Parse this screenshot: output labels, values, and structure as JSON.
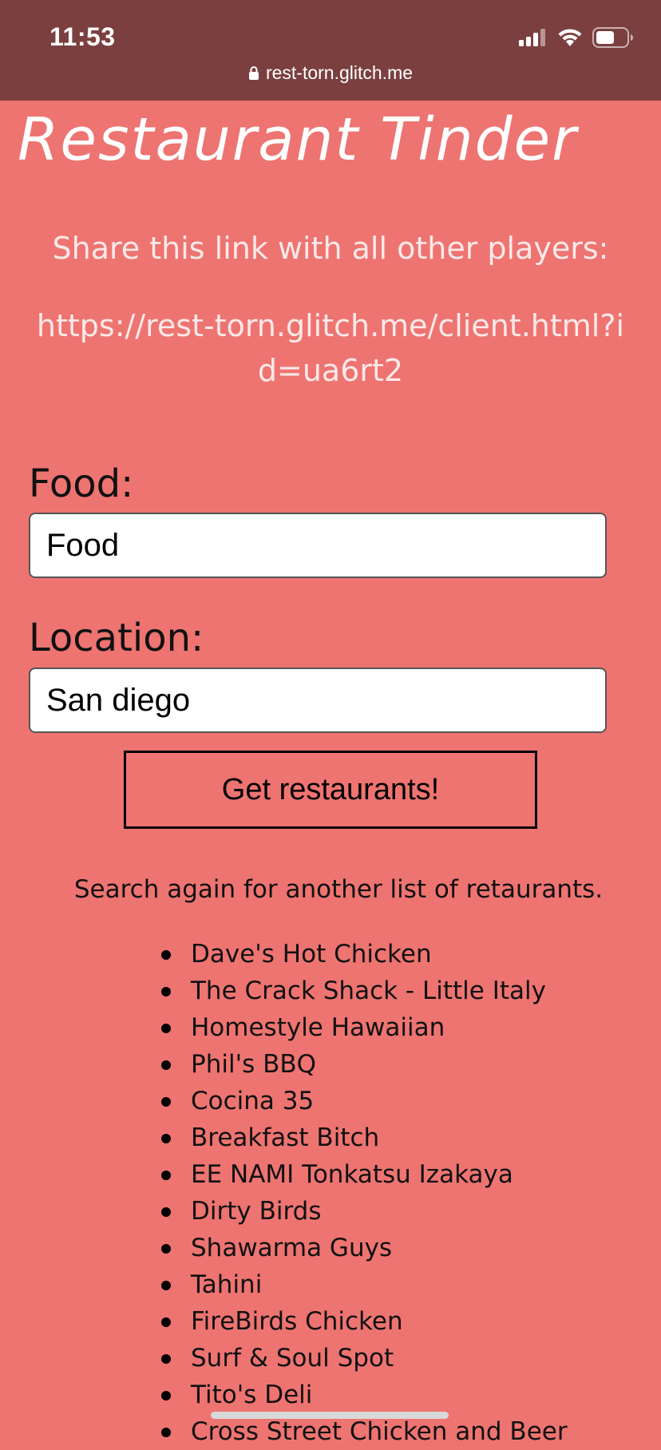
{
  "status_bar": {
    "time": "11:53",
    "url": "rest-torn.glitch.me",
    "icons": [
      "cellular-signal-icon",
      "wifi-icon",
      "battery-icon",
      "lock-icon"
    ]
  },
  "page": {
    "title": "Restaurant Tinder",
    "share_text": "Share this link with all other players:",
    "share_link": "https://rest-torn.glitch.me/client.html?id=ua6rt2"
  },
  "form": {
    "food_label": "Food:",
    "food_value": "Food",
    "location_label": "Location:",
    "location_value": "San diego",
    "submit_label": "Get restaurants!"
  },
  "results": {
    "hint": "Search again for another list of retaurants.",
    "restaurants": [
      "Dave's Hot Chicken",
      "The Crack Shack - Little Italy",
      "Homestyle Hawaiian",
      "Phil's BBQ",
      "Cocina 35",
      "Breakfast Bitch",
      "EE NAMI Tonkatsu Izakaya",
      "Dirty Birds",
      "Shawarma Guys",
      "Tahini",
      "FireBirds Chicken",
      "Surf & Soul Spot",
      "Tito's Deli",
      "Cross Street Chicken and Beer"
    ]
  },
  "colors": {
    "background": "#ee7471",
    "status_bar": "#7b3f3f",
    "title": "#ffffff"
  }
}
